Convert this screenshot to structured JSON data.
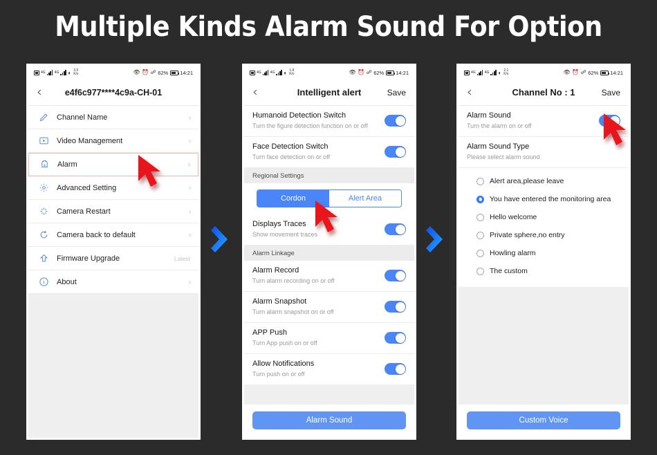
{
  "title": "Multiple Kinds Alarm Sound For Option",
  "colors": {
    "background": "#2b2b2b",
    "accent_blue": "#4a86f7",
    "button_blue": "#6195f3",
    "icon_blue": "#5b8bd0",
    "cursor_red": "#e8151c",
    "highlight_border": "#f3b3b3"
  },
  "status_bar": {
    "battery_percent": "62%",
    "time": "14:21",
    "speeds": [
      "3.5",
      "1.8",
      "2.1"
    ],
    "speed_unit": "K/s",
    "icons": [
      "sdcard-icon",
      "signal-icon",
      "signal-icon",
      "wifi-icon",
      "eye-icon",
      "alarm-clock-icon",
      "bluetooth-icon",
      "battery-icon"
    ]
  },
  "phone1": {
    "nav": {
      "title": "e4f6c977****4c9a-CH-01",
      "back": "‹"
    },
    "menu": [
      {
        "label": "Channel Name",
        "icon": "pencil-icon",
        "note": "",
        "chevron": "›",
        "highlighted": false
      },
      {
        "label": "Video Management",
        "icon": "video-icon",
        "note": "",
        "chevron": "›",
        "highlighted": false
      },
      {
        "label": "Alarm",
        "icon": "alarm-bell-icon",
        "note": "",
        "chevron": "›",
        "highlighted": true
      },
      {
        "label": "Advanced Setting",
        "icon": "gear-icon",
        "note": "",
        "chevron": "›",
        "highlighted": false
      },
      {
        "label": "Camera Restart",
        "icon": "restart-icon",
        "note": "",
        "chevron": "›",
        "highlighted": false
      },
      {
        "label": "Camera back to default",
        "icon": "reset-icon",
        "note": "",
        "chevron": "›",
        "highlighted": false
      },
      {
        "label": "Firmware Upgrade",
        "icon": "upgrade-arrow-icon",
        "note": "Latest",
        "chevron": "",
        "highlighted": false
      },
      {
        "label": "About",
        "icon": "info-icon",
        "note": "",
        "chevron": "›",
        "highlighted": false
      }
    ]
  },
  "phone2": {
    "nav": {
      "title": "Intelligent alert",
      "back": "‹",
      "save": "Save"
    },
    "switches_top": [
      {
        "title": "Humanoid Detection Switch",
        "subtitle": "Turn the figure detection function on or off",
        "on": true
      },
      {
        "title": "Face Detection Switch",
        "subtitle": "Turn face detection on or off",
        "on": true
      }
    ],
    "regional_section": "Regional Settings",
    "segmented": [
      {
        "label": "Cordon",
        "active": true
      },
      {
        "label": "Alert Area",
        "active": false
      }
    ],
    "traces": {
      "title": "Displays Traces",
      "subtitle": "Show movement traces",
      "on": true
    },
    "linkage_section": "Alarm Linkage",
    "switches_linkage": [
      {
        "title": "Alarm Record",
        "subtitle": "Turn alarm recording on or off",
        "on": true
      },
      {
        "title": "Alarm Snapshot",
        "subtitle": "Turn alarm snapshot on or off",
        "on": true
      },
      {
        "title": "APP Push",
        "subtitle": "Turn App push on or off",
        "on": true
      },
      {
        "title": "Allow Notifications",
        "subtitle": "Turn push on or off",
        "on": true
      }
    ],
    "cta": "Alarm Sound"
  },
  "phone3": {
    "nav": {
      "title": "Channel No : 1",
      "back": "‹",
      "save": "Save"
    },
    "alarm_sound": {
      "title": "Alarm Sound",
      "subtitle": "Turn the alarm on or off",
      "on": true
    },
    "sound_type": {
      "title": "Alarm Sound Type",
      "subtitle": "Please select alarm sound"
    },
    "options": [
      {
        "label": "Alert area,please leave",
        "selected": false
      },
      {
        "label": "You have entered the monitoring area",
        "selected": true
      },
      {
        "label": "Hello welcome",
        "selected": false
      },
      {
        "label": "Private sphere,no entry",
        "selected": false
      },
      {
        "label": "Howling alarm",
        "selected": false
      },
      {
        "label": "The custom",
        "selected": false
      }
    ],
    "cta": "Custom Voice"
  },
  "separators": [
    "chevron-right-icon",
    "chevron-right-icon"
  ],
  "cursors": [
    "cursor-arrow-icon",
    "cursor-arrow-icon",
    "cursor-arrow-icon"
  ]
}
